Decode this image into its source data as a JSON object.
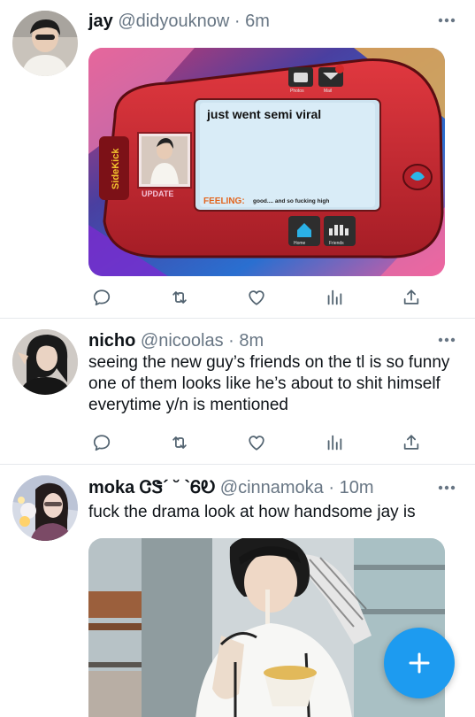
{
  "colors": {
    "accent": "#1d9bf0",
    "text": "#0f1419",
    "secondary": "#687684",
    "divider": "#e6e9ec"
  },
  "tweets": [
    {
      "name": "jay",
      "handle": "@didyouknow",
      "separator": "·",
      "time": "6m",
      "text": "",
      "media": {
        "type": "image",
        "status_text": "just went semi viral",
        "feeling_label": "FEELING:",
        "feeling_text": "good.... and so fucking high",
        "update_label": "UPDATE",
        "brand": "SideKick",
        "tabs": [
          "Photos",
          "Mail",
          "Home",
          "Friends"
        ]
      },
      "actions": [
        "reply-icon",
        "retweet-icon",
        "like-icon",
        "views-icon",
        "share-icon"
      ]
    },
    {
      "name": "nicho",
      "handle": "@nicoolas",
      "separator": "·",
      "time": "8m",
      "text": "seeing the new guy’s friends on the tl is so funny one of them looks like he’s about to shit himself everytime y/n is mentioned",
      "actions": [
        "reply-icon",
        "retweet-icon",
        "like-icon",
        "views-icon",
        "share-icon"
      ]
    },
    {
      "name": "moka ᏣᏕ´ ˘ `ᏮᎧ",
      "handle": "@cinnamoka",
      "separator": "·",
      "time": "10m",
      "text": "fuck the drama look at how handsome jay is",
      "media": {
        "type": "photo"
      }
    }
  ],
  "fab": {
    "icon": "plus-icon"
  }
}
